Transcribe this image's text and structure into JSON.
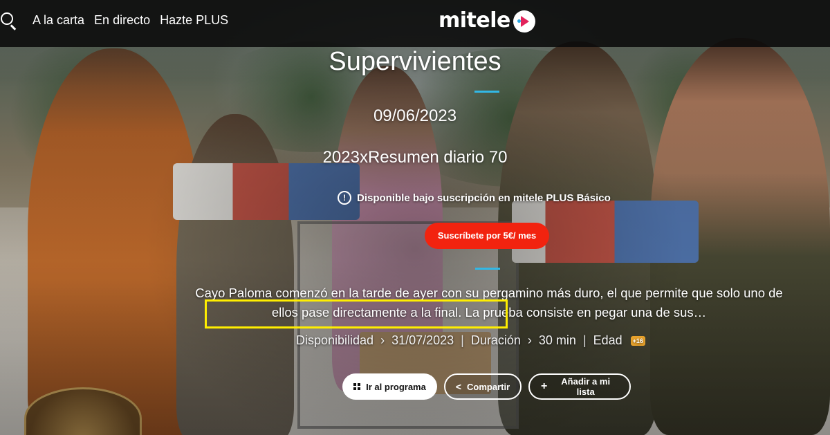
{
  "nav": {
    "search_icon": "search-icon",
    "items": [
      {
        "label": "A la carta"
      },
      {
        "label": "En directo"
      },
      {
        "label": "Hazte PLUS"
      }
    ],
    "brand": "mitele"
  },
  "hero": {
    "title": "Supervivientes",
    "date": "09/06/2023",
    "episode": "2023xResumen diario 70",
    "availability": "Disponible bajo suscripción en mitele PLUS Básico",
    "subscribe_label": "Suscríbete por 5€/ mes",
    "description": "Cayo Paloma comenzó en la tarde de ayer con su pergamino más duro, el que permite que solo uno de ellos pase directamente a la final. La prueba consiste en pegar una de sus…",
    "meta": {
      "availability_label": "Disponibilidad",
      "availability_value": "31/07/2023",
      "duration_label": "Duración",
      "duration_value": "30 min",
      "age_label": "Edad",
      "age_badge": "+16",
      "arrow": "›",
      "separator": "|"
    },
    "actions": {
      "program": "Ir al programa",
      "share": "Compartir",
      "add_list": "Añadir a mi lista"
    }
  },
  "colors": {
    "accent_line": "#32b8e6",
    "subscribe_bg": "#f2230f",
    "highlight": "#ffee00",
    "age_badge": "#e8a22c"
  }
}
